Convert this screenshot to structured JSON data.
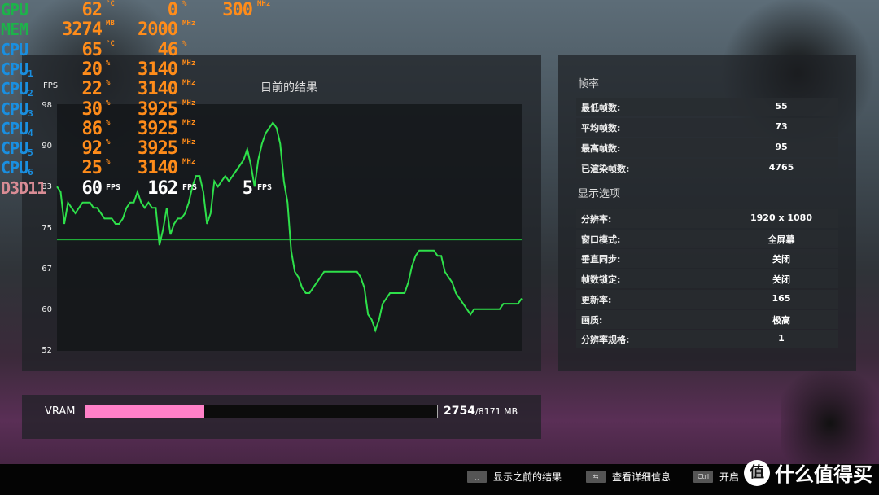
{
  "osd": [
    {
      "label": "GPU",
      "sub": "",
      "color": "#1db34a",
      "v1": "62",
      "u1": "°C",
      "v2": "0",
      "u2": "%",
      "v3": "300",
      "u3": "MHz"
    },
    {
      "label": "MEM",
      "sub": "",
      "color": "#1db34a",
      "v1": "3274",
      "u1": "MB",
      "v2": "2000",
      "u2": "MHz",
      "v3": "",
      "u3": ""
    },
    {
      "label": "CPU",
      "sub": "",
      "color": "#1a8fe0",
      "v1": "65",
      "u1": "°C",
      "v2": "46",
      "u2": "%",
      "v3": "",
      "u3": ""
    },
    {
      "label": "CPU",
      "sub": "1",
      "color": "#1a8fe0",
      "v1": "20",
      "u1": "%",
      "v2": "3140",
      "u2": "MHz",
      "v3": "",
      "u3": ""
    },
    {
      "label": "CPU",
      "sub": "2",
      "color": "#1a8fe0",
      "v1": "22",
      "u1": "%",
      "v2": "3140",
      "u2": "MHz",
      "v3": "",
      "u3": ""
    },
    {
      "label": "CPU",
      "sub": "3",
      "color": "#1a8fe0",
      "v1": "30",
      "u1": "%",
      "v2": "3925",
      "u2": "MHz",
      "v3": "",
      "u3": ""
    },
    {
      "label": "CPU",
      "sub": "4",
      "color": "#1a8fe0",
      "v1": "86",
      "u1": "%",
      "v2": "3925",
      "u2": "MHz",
      "v3": "",
      "u3": ""
    },
    {
      "label": "CPU",
      "sub": "5",
      "color": "#1a8fe0",
      "v1": "92",
      "u1": "%",
      "v2": "3925",
      "u2": "MHz",
      "v3": "",
      "u3": ""
    },
    {
      "label": "CPU",
      "sub": "6",
      "color": "#1a8fe0",
      "v1": "25",
      "u1": "%",
      "v2": "3140",
      "u2": "MHz",
      "v3": "",
      "u3": ""
    },
    {
      "label": "D3D11",
      "sub": "",
      "color": "#d98c95",
      "v1": "60",
      "u1": "FPS",
      "v2": "162",
      "u2": "FPS",
      "v3": "5",
      "u3": "FPS",
      "white": true
    }
  ],
  "chart_data": {
    "type": "line",
    "title": "目前的结果",
    "ylabel": "FPS",
    "yticks": [
      "98",
      "90",
      "83",
      "75",
      "67",
      "60",
      "52"
    ],
    "ylim": [
      52,
      98
    ],
    "line_color": "#2ee04a",
    "average_line": 73,
    "values": [
      83,
      82,
      76,
      80,
      79,
      78,
      79,
      80,
      80,
      80,
      79,
      79,
      78,
      77,
      77,
      77,
      76,
      76,
      77,
      79,
      80,
      80,
      82,
      80,
      79,
      80,
      79,
      79,
      72,
      75,
      79,
      74,
      76,
      77,
      77,
      78,
      80,
      83,
      85,
      85,
      82,
      76,
      78,
      84,
      83,
      84,
      85,
      84,
      85,
      86,
      87,
      88,
      90,
      87,
      83,
      88,
      91,
      93,
      94,
      95,
      94,
      91,
      84,
      80,
      71,
      67,
      66,
      64,
      63,
      63,
      64,
      65,
      66,
      67,
      67,
      67,
      67,
      67,
      67,
      67,
      67,
      67,
      67,
      66,
      64,
      59,
      58,
      56,
      58,
      61,
      62,
      63,
      63,
      63,
      63,
      63,
      65,
      68,
      70,
      71,
      71,
      71,
      71,
      71,
      70,
      70,
      67,
      66,
      65,
      63,
      62,
      61,
      60,
      59,
      60,
      60,
      60,
      60,
      60,
      60,
      60,
      60,
      61,
      61,
      61,
      61,
      61,
      62
    ]
  },
  "right": {
    "fps_heading": "帧率",
    "fps_rows": [
      {
        "k": "最低帧数:",
        "v": "55"
      },
      {
        "k": "平均帧数:",
        "v": "73"
      },
      {
        "k": "最高帧数:",
        "v": "95"
      },
      {
        "k": "已渲染帧数:",
        "v": "4765"
      }
    ],
    "display_heading": "显示选项",
    "display_rows": [
      {
        "k": "分辨率:",
        "v": "1920 x 1080"
      },
      {
        "k": "窗口模式:",
        "v": "全屏幕"
      },
      {
        "k": "垂直同步:",
        "v": "关闭"
      },
      {
        "k": "帧数锁定:",
        "v": "关闭"
      },
      {
        "k": "更新率:",
        "v": "165"
      },
      {
        "k": "画质:",
        "v": "极高"
      },
      {
        "k": "分辨率规格:",
        "v": "1"
      }
    ]
  },
  "vram": {
    "label": "VRAM",
    "used": "2754",
    "total": "/8171 MB",
    "fraction": 0.337,
    "color": "#ff80c8"
  },
  "bottom": [
    {
      "key": "⎵",
      "label": "显示之前的结果"
    },
    {
      "key": "⇆",
      "label": "查看详细信息"
    },
    {
      "key": "Ctrl",
      "label": "开启"
    }
  ],
  "watermark": {
    "badge": "值",
    "text": "什么值得买"
  }
}
